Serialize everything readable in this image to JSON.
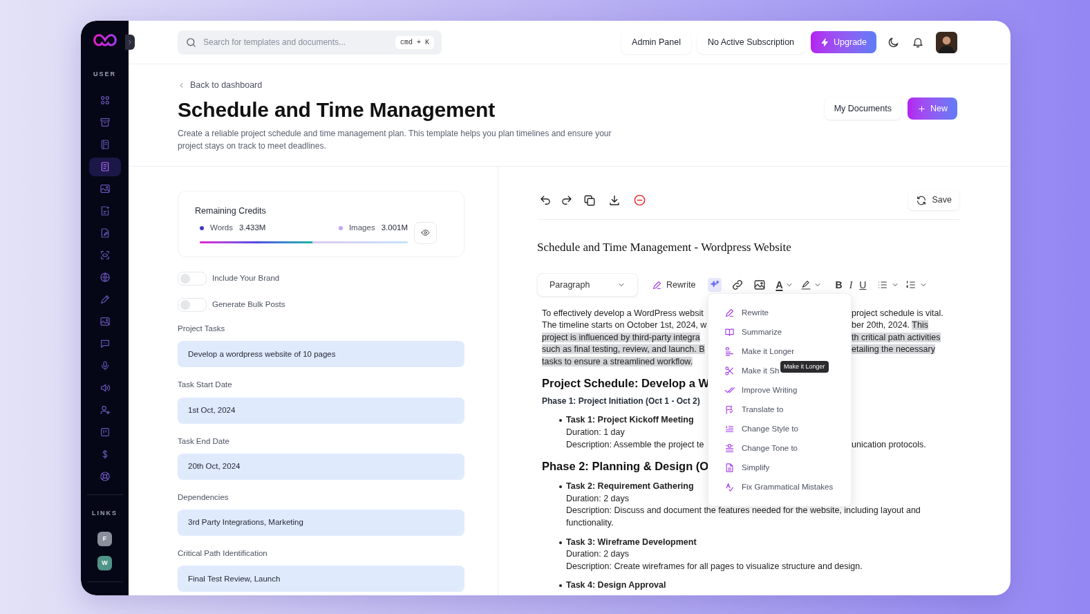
{
  "sidebar": {
    "section_user": "USER",
    "items": [
      {
        "selected": false
      },
      {
        "selected": false
      },
      {
        "selected": false
      },
      {
        "selected": true
      },
      {
        "selected": false
      },
      {
        "selected": false
      },
      {
        "selected": false
      },
      {
        "selected": false
      },
      {
        "selected": false
      },
      {
        "selected": false
      },
      {
        "selected": false
      },
      {
        "selected": false
      },
      {
        "selected": false
      },
      {
        "selected": false
      },
      {
        "selected": false
      },
      {
        "selected": false
      },
      {
        "selected": false
      },
      {
        "selected": false
      }
    ],
    "section_links": "LINKS",
    "links": [
      {
        "label": "F",
        "color": "#8b8f9c"
      },
      {
        "label": "W",
        "color": "#4f9488"
      }
    ]
  },
  "topbar": {
    "search": {
      "placeholder": "Search for templates and documents...",
      "shortcut": "cmd + K"
    },
    "buttons": [
      "Admin Panel",
      "No Active Subscription"
    ],
    "upgrade": "Upgrade"
  },
  "header": {
    "back": "Back to dashboard",
    "title": "Schedule and Time Management",
    "description": "Create a reliable project schedule and time management plan. This template helps you plan timelines and ensure your project stays on track to meet deadlines.",
    "my_documents": "My Documents",
    "new": "New"
  },
  "credits": {
    "title": "Remaining Credits",
    "items": [
      {
        "name": "Words",
        "value": "3.433M",
        "color": "#4338ca"
      },
      {
        "name": "Images",
        "value": "3.001M",
        "color": "#c4a5f5"
      }
    ],
    "level": 0.54
  },
  "toggles": [
    {
      "label": "Include Your Brand",
      "on": false
    },
    {
      "label": "Generate Bulk Posts",
      "on": false
    }
  ],
  "fields": [
    {
      "label": "Project Tasks",
      "value": "Develop a wordpress website of 10 pages"
    },
    {
      "label": "Task Start Date",
      "value": "1st Oct, 2024"
    },
    {
      "label": "Task End Date",
      "value": "20th Oct, 2024"
    },
    {
      "label": "Dependencies",
      "value": "3rd Party Integrations, Marketing"
    },
    {
      "label": "Critical Path Identification",
      "value": "Final Test Review, Launch"
    }
  ],
  "editor": {
    "save": "Save",
    "doc_title": "Schedule and Time Management - Wordpress Website",
    "format": "Paragraph",
    "rewrite": "Rewrite",
    "text_color": "A",
    "format_buttons": [
      "B",
      "I",
      "U"
    ],
    "ai_menu": {
      "expanded": true,
      "items": [
        "Rewrite",
        "Summarize",
        "Make it Longer",
        "Make it Sh",
        "Improve Writing",
        "Translate to",
        "Change Style to",
        "Change Tone to",
        "Simplify",
        "Fix Grammatical Mistakes"
      ],
      "tooltip": "Make it Longer"
    },
    "content": [
      {
        "kind": "paragraph",
        "lines": [
          {
            "left": [
              {
                "text": "To effectively develop a WordPress websit",
                "highlighted": false
              }
            ],
            "right": [
              {
                "text": "project schedule is vital.",
                "highlighted": false
              }
            ]
          },
          {
            "left": [
              {
                "text": "The timeline starts on October 1st, 2024, w",
                "highlighted": false
              }
            ],
            "right": [
              {
                "text": "ber 20th, 2024. ",
                "highlighted": false
              },
              {
                "text": "This",
                "highlighted": true
              }
            ]
          },
          {
            "left": [
              {
                "text": "project is influenced by third-party integra",
                "highlighted": true
              }
            ],
            "right": [
              {
                "text": "th critical path activities",
                "highlighted": true
              }
            ]
          },
          {
            "left": [
              {
                "text": "such as final testing, review, and launch. B",
                "highlighted": true
              }
            ],
            "right": [
              {
                "text": "etailing the necessary",
                "highlighted": true
              }
            ]
          },
          {
            "left": [
              {
                "text": "tasks to ensure a streamlined workflow.",
                "highlighted": true
              }
            ]
          }
        ]
      },
      {
        "kind": "heading",
        "text": "Project Schedule: Develop a W"
      },
      {
        "kind": "subheading",
        "text": "Phase 1: Project Initiation (Oct 1 - Oct 2)"
      },
      {
        "kind": "task",
        "title": "Task 1: Project Kickoff Meeting",
        "lines": [
          {
            "left": [
              {
                "text": "Duration: 1 day",
                "highlighted": false
              }
            ]
          },
          {
            "left": [
              {
                "text": "Description: Assemble the project te",
                "highlighted": false
              }
            ],
            "right": [
              {
                "text": "unication protocols.",
                "highlighted": false
              }
            ]
          }
        ]
      },
      {
        "kind": "heading",
        "text": "Phase 2: Planning & Design (O"
      },
      {
        "kind": "task",
        "title": "Task 2: Requirement Gathering",
        "lines": [
          {
            "left": [
              {
                "text": "Duration: 2 days",
                "highlighted": false
              }
            ]
          },
          {
            "left": [
              {
                "text": "Description: Discuss and document the features needed for the website, including layout and functionality.",
                "highlighted": false
              }
            ]
          }
        ]
      },
      {
        "kind": "task",
        "title": "Task 3: Wireframe Development",
        "lines": [
          {
            "left": [
              {
                "text": "Duration: 2 days",
                "highlighted": false
              }
            ]
          },
          {
            "left": [
              {
                "text": "Description: Create wireframes for all pages to visualize structure and design.",
                "highlighted": false
              }
            ]
          }
        ]
      },
      {
        "kind": "task",
        "title": "Task 4: Design Approval"
      }
    ]
  }
}
